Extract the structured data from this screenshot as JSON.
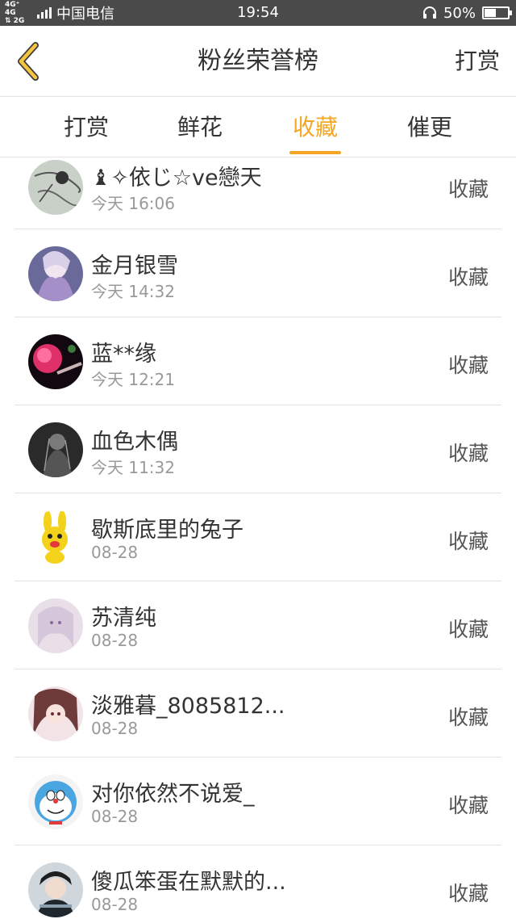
{
  "status_bar": {
    "network": "4G⁺ 4G\n2G",
    "carrier": "中国电信",
    "time": "19:54",
    "battery_percent": "50%",
    "battery_level": 0.5
  },
  "navbar": {
    "title": "粉丝荣誉榜",
    "right_action": "打赏",
    "back_icon": "chevron-left-icon",
    "back_color": "#f5a623"
  },
  "tabs": [
    {
      "label": "打赏",
      "active": false
    },
    {
      "label": "鲜花",
      "active": false
    },
    {
      "label": "收藏",
      "active": true
    },
    {
      "label": "催更",
      "active": false
    }
  ],
  "accent_color": "#f5a623",
  "fans": [
    {
      "name": "♝✧依じ☆ve戀天",
      "time": "今天 16:06",
      "action": "收藏",
      "avatar": "sketch"
    },
    {
      "name": "金月银雪",
      "time": "今天 14:32",
      "action": "收藏",
      "avatar": "anime-purple"
    },
    {
      "name": "蓝**缘",
      "time": "今天 12:21",
      "action": "收藏",
      "avatar": "pink-flower"
    },
    {
      "name": "血色木偶",
      "time": "今天 11:32",
      "action": "收藏",
      "avatar": "dark-figure"
    },
    {
      "name": "歇斯底里的兔子",
      "time": "08-28",
      "action": "收藏",
      "avatar": "yellow-bunny"
    },
    {
      "name": "苏清纯",
      "time": "08-28",
      "action": "收藏",
      "avatar": "anime-pale"
    },
    {
      "name": "淡雅暮_8085812...",
      "time": "08-28",
      "action": "收藏",
      "avatar": "anime-brown"
    },
    {
      "name": "对你依然不说爱_",
      "time": "08-28",
      "action": "收藏",
      "avatar": "doraemon"
    },
    {
      "name": "傻瓜笨蛋在默默的...",
      "time": "08-28",
      "action": "收藏",
      "avatar": "boy-photo"
    }
  ]
}
